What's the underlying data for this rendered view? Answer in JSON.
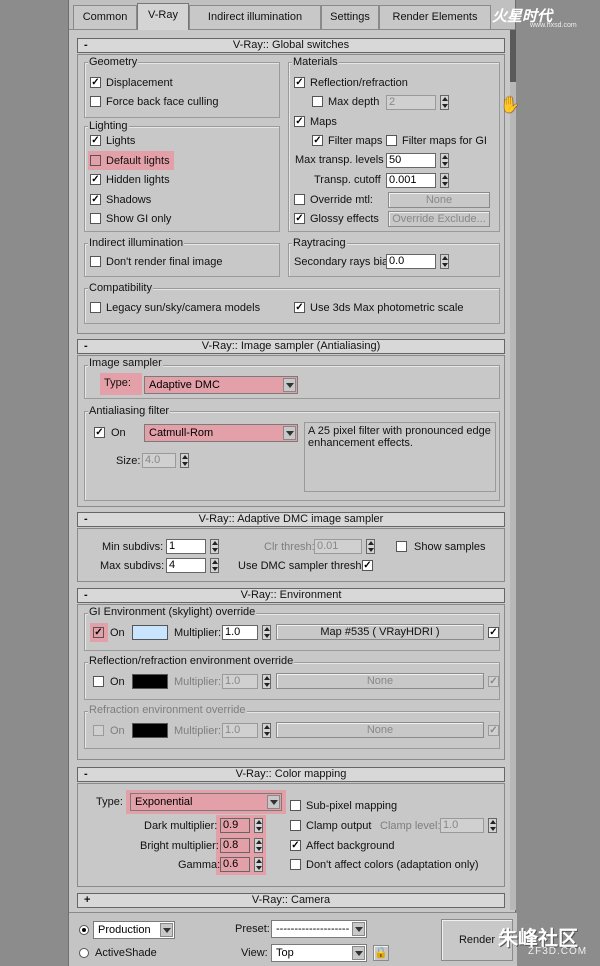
{
  "tabs": [
    "Common",
    "V-Ray",
    "Indirect illumination",
    "Settings",
    "Render Elements"
  ],
  "watermark_top": {
    "main": "火星时代",
    "sub": "www.hxsd.com"
  },
  "watermark_bottom": {
    "main": "朱峰社区",
    "sub": "ZF3D.COM"
  },
  "global": {
    "title": "V-Ray:: Global switches",
    "geometry": {
      "label": "Geometry",
      "displacement": "Displacement",
      "force_back": "Force back face culling"
    },
    "lighting": {
      "label": "Lighting",
      "lights": "Lights",
      "default_lights": "Default lights",
      "hidden_lights": "Hidden lights",
      "shadows": "Shadows",
      "show_gi_only": "Show GI only"
    },
    "materials": {
      "label": "Materials",
      "reflection": "Reflection/refraction",
      "max_depth": "Max depth",
      "max_depth_val": "2",
      "maps": "Maps",
      "filter_maps": "Filter maps",
      "filter_maps_gi": "Filter maps for GI",
      "max_transp": "Max transp. levels",
      "max_transp_val": "50",
      "transp_cutoff": "Transp. cutoff",
      "transp_cutoff_val": "0.001",
      "override_mtl": "Override mtl:",
      "none": "None",
      "glossy": "Glossy effects",
      "override_exclude": "Override Exclude..."
    },
    "indirect": {
      "label": "Indirect illumination",
      "dont_render": "Don't render final image"
    },
    "raytracing": {
      "label": "Raytracing",
      "bias": "Secondary rays bias",
      "bias_val": "0.0"
    },
    "compat": {
      "label": "Compatibility",
      "legacy": "Legacy sun/sky/camera models",
      "photometric": "Use 3ds Max photometric scale"
    }
  },
  "sampler": {
    "title": "V-Ray:: Image sampler (Antialiasing)",
    "image_sampler": "Image sampler",
    "type": "Type:",
    "type_val": "Adaptive DMC",
    "aa_filter": "Antialiasing filter",
    "on": "On",
    "filter_val": "Catmull-Rom",
    "desc": "A 25 pixel filter with pronounced edge enhancement effects.",
    "size": "Size:",
    "size_val": "4.0"
  },
  "dmc": {
    "title": "V-Ray:: Adaptive DMC image sampler",
    "min": "Min subdivs:",
    "min_val": "1",
    "max": "Max subdivs:",
    "max_val": "4",
    "clr": "Clr thresh:",
    "clr_val": "0.01",
    "show": "Show samples",
    "use_dmc": "Use DMC sampler thresh."
  },
  "env": {
    "title": "V-Ray:: Environment",
    "gi": "GI Environment (skylight) override",
    "on": "On",
    "mult": "Multiplier:",
    "gi_mult": "1.0",
    "gi_map": "Map #535  ( VRayHDRI )",
    "refl": "Reflection/refraction environment override",
    "refl_mult": "1.0",
    "none": "None",
    "refr": "Refraction environment override",
    "refr_mult": "1.0",
    "colors": {
      "gi": "#c8e4ff",
      "refl": "#000000",
      "refr": "#000000"
    }
  },
  "cmap": {
    "title": "V-Ray:: Color mapping",
    "type": "Type:",
    "type_val": "Exponential",
    "subpixel": "Sub-pixel mapping",
    "dark": "Dark multiplier:",
    "dark_val": "0.9",
    "clamp": "Clamp output",
    "clamp_level": "Clamp level:",
    "clamp_level_val": "1.0",
    "bright": "Bright multiplier:",
    "bright_val": "0.8",
    "affect_bg": "Affect background",
    "gamma": "Gamma:",
    "gamma_val": "0.6",
    "dont_affect": "Don't affect colors (adaptation only)"
  },
  "camera": {
    "title": "V-Ray:: Camera"
  },
  "bottom": {
    "production": "Production",
    "activeshade": "ActiveShade",
    "preset": "Preset:",
    "preset_val": "--------------------",
    "view": "View:",
    "view_val": "Top",
    "render": "Render"
  },
  "highlight_color": "#e4a0a8"
}
